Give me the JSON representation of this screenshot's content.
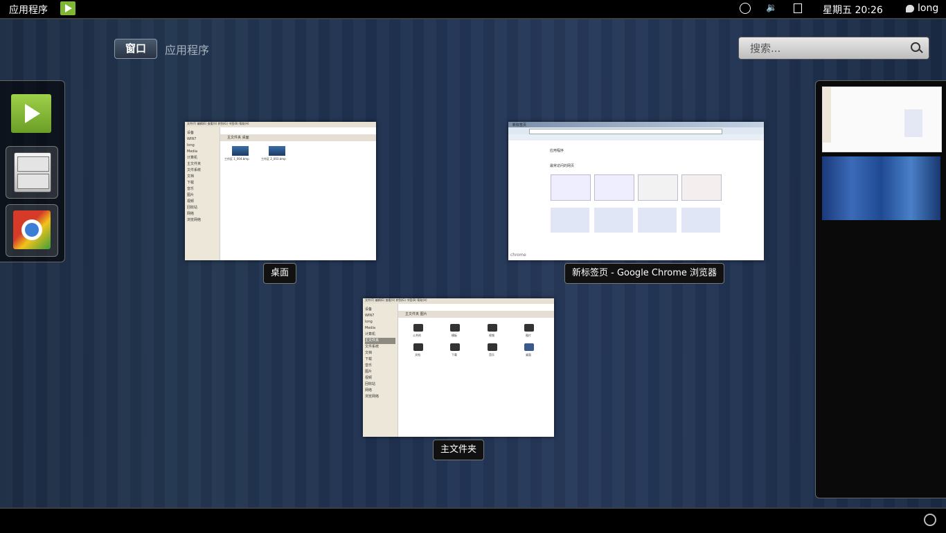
{
  "topbar": {
    "activities_label": "应用程序",
    "clock": "星期五 20:26",
    "user": "long"
  },
  "overview": {
    "tabs": [
      {
        "label": "窗口",
        "selected": true
      },
      {
        "label": "应用程序",
        "selected": false
      }
    ],
    "search_placeholder": "搜索..."
  },
  "dash": {
    "items": [
      {
        "name": "media-player-icon"
      },
      {
        "name": "file-cabinet-icon"
      },
      {
        "name": "chrome-icon"
      }
    ]
  },
  "windows": [
    {
      "caption": "桌面",
      "menu": "文件(F)  编辑(E)  查看(V)  转到(G)  书签(B)  帮助(H)",
      "path": "主文件夹   桌面",
      "sidebar": [
        "设备",
        "WIN7",
        "long",
        "Media",
        "计算机",
        "主文件夹",
        "文件系统",
        "文档",
        "下载",
        "音乐",
        "图片",
        "视频",
        "回收站",
        "网络",
        "浏览网络"
      ],
      "files": [
        "工作区 1_004.bmp",
        "工作区 2_003.bmp"
      ]
    },
    {
      "caption": "新标签页 - Google Chrome 浏览器",
      "tab": "新标签页",
      "apps_heading": "应用程序",
      "recent_heading": "最常访问的网页",
      "footer": "chrome"
    },
    {
      "caption": "主文件夹",
      "menu": "文件(F)  编辑(E)  查看(V)  转到(G)  书签(B)  帮助(H)",
      "path": "主文件夹   图片",
      "sidebar": [
        "设备",
        "WIN7",
        "long",
        "Media",
        "计算机",
        "主文件夹",
        "文件系统",
        "文档",
        "下载",
        "音乐",
        "图片",
        "视频",
        "回收站",
        "网络",
        "浏览网络"
      ],
      "folders": [
        "公共的",
        "模板",
        "视频",
        "图片",
        "文档",
        "下载",
        "音乐",
        "桌面"
      ]
    }
  ],
  "colors": {
    "accent_green": "#7fb734",
    "panel_black": "#000000",
    "bg_blue": "#233650"
  }
}
